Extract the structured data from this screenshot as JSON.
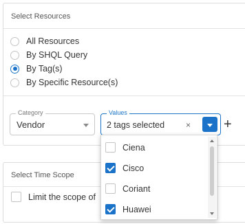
{
  "resources_panel": {
    "title": "Select Resources",
    "options": [
      {
        "label": "All Resources",
        "checked": false
      },
      {
        "label": "By SHQL Query",
        "checked": false
      },
      {
        "label": "By Tag(s)",
        "checked": true
      },
      {
        "label": "By Specific Resource(s)",
        "checked": false
      }
    ],
    "category": {
      "legend": "Category",
      "value": "Vendor"
    },
    "values": {
      "legend": "Values",
      "selected_text": "2 tags selected",
      "clear_glyph": "×"
    },
    "add_glyph": "+"
  },
  "dropdown": {
    "items": [
      {
        "label": "Ciena",
        "checked": false
      },
      {
        "label": "Cisco",
        "checked": true
      },
      {
        "label": "Coriant",
        "checked": false
      },
      {
        "label": "Huawei",
        "checked": true
      }
    ]
  },
  "time_panel": {
    "title": "Select Time Scope",
    "limit_label": "Limit the scope of re"
  },
  "colors": {
    "accent": "#1a73c8",
    "border": "#dcdcdc"
  }
}
